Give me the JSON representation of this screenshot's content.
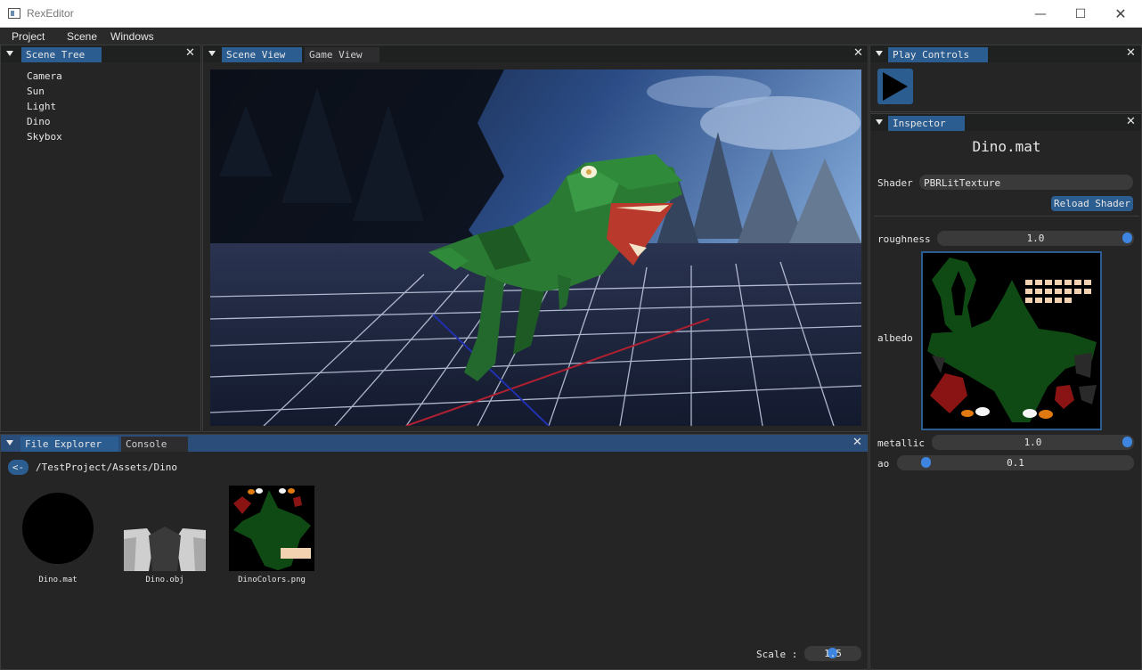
{
  "window": {
    "title": "RexEditor"
  },
  "menu": [
    "Project",
    "Scene",
    "Windows"
  ],
  "scene_tree": {
    "tab": "Scene Tree",
    "items": [
      "Camera",
      "Sun",
      "Light",
      "Dino",
      "Skybox"
    ]
  },
  "viewport": {
    "tabs": [
      "Scene View",
      "Game View"
    ],
    "active_tab": "Scene View"
  },
  "play_controls": {
    "tab": "Play Controls",
    "play_icon": "play-icon"
  },
  "inspector": {
    "tab": "Inspector",
    "title": "Dino.mat",
    "shader_label": "Shader",
    "shader_value": "PBRLitTexture",
    "reload_button": "Reload Shader",
    "roughness_label": "roughness",
    "roughness_value": "1.0",
    "roughness_level": 1.0,
    "albedo_label": "albedo",
    "metallic_label": "metallic",
    "metallic_value": "1.0",
    "metallic_level": 1.0,
    "ao_label": "ao",
    "ao_value": "0.1",
    "ao_level": 0.1
  },
  "bottom_panel": {
    "tabs": [
      "File Explorer",
      "Console"
    ],
    "active_tab": "File Explorer",
    "back_button": "<-",
    "path": "/TestProject/Assets/Dino",
    "files": [
      {
        "name": "Dino.mat",
        "icon": "sphere-thumbnail"
      },
      {
        "name": "Dino.obj",
        "icon": "mesh-thumbnail"
      },
      {
        "name": "DinoColors.png",
        "icon": "texture-thumbnail"
      }
    ],
    "scale_label": "Scale :",
    "scale_value": "1.5",
    "scale_level": 0.5
  },
  "colors": {
    "accent": "#2c5d91",
    "panel_bg": "#252526",
    "slider_knob": "#3d85e0"
  }
}
